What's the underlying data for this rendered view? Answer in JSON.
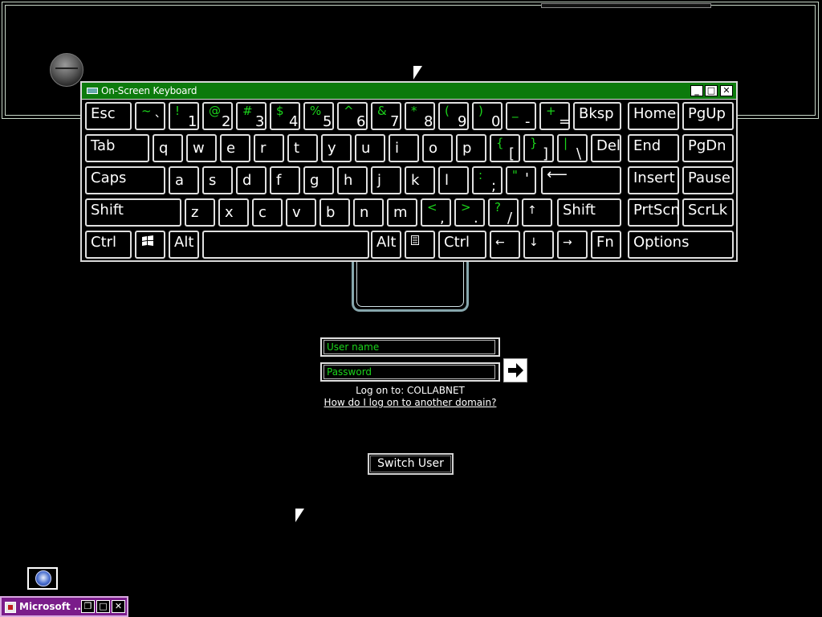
{
  "osk": {
    "title": "On-Screen Keyboard",
    "minimize": "_",
    "maximize": "□",
    "close": "✕"
  },
  "keys": {
    "esc": "Esc",
    "tab": "Tab",
    "caps": "Caps",
    "shift_l": "Shift",
    "ctrl_l": "Ctrl",
    "alt_l": "Alt",
    "alt_r": "Alt",
    "ctrl_r": "Ctrl",
    "fn": "Fn",
    "options": "Options",
    "bksp": "Bksp",
    "del": "Del",
    "shift_r": "Shift",
    "home": "Home",
    "pgup": "PgUp",
    "end": "End",
    "pgdn": "PgDn",
    "insert": "Insert",
    "pause": "Pause",
    "prtscn": "PrtScn",
    "scrlk": "ScrLk",
    "n1": [
      "!",
      "1"
    ],
    "n2": [
      "@",
      "2"
    ],
    "n3": [
      "#",
      "3"
    ],
    "n4": [
      "$",
      "4"
    ],
    "n5": [
      "%",
      "5"
    ],
    "n6": [
      "^",
      "6"
    ],
    "n7": [
      "&",
      "7"
    ],
    "n8": [
      "*",
      "8"
    ],
    "n9": [
      "(",
      "9"
    ],
    "n0": [
      ")",
      "0"
    ],
    "tilde": [
      "~",
      "`"
    ],
    "minus": [
      "_",
      "-"
    ],
    "equals": [
      "+",
      "="
    ],
    "lbr": [
      "{",
      "["
    ],
    "rbr": [
      "}",
      "]"
    ],
    "bslash": [
      "|",
      "\\"
    ],
    "semi": [
      ":",
      ";"
    ],
    "quote": [
      "\"",
      "'"
    ],
    "comma": [
      "<",
      ","
    ],
    "period": [
      ">",
      "."
    ],
    "slash": [
      "?",
      "/"
    ],
    "q": "q",
    "w": "w",
    "e": "e",
    "r": "r",
    "t": "t",
    "y": "y",
    "u": "u",
    "i": "i",
    "o": "o",
    "p": "p",
    "a": "a",
    "s": "s",
    "d": "d",
    "f": "f",
    "g": "g",
    "h": "h",
    "j": "j",
    "k": "k",
    "l": "l",
    "z": "z",
    "x": "x",
    "c": "c",
    "v": "v",
    "b": "b",
    "n": "n",
    "m": "m",
    "up": "↑",
    "down": "↓",
    "left": "←",
    "right": "→",
    "enter": "⟵"
  },
  "login": {
    "username_placeholder": "User name",
    "password_placeholder": "Password",
    "logon_to": "Log on to: COLLABNET",
    "other_domain_link": "How do I log on to another domain?",
    "switch_user": "Switch User"
  },
  "taskbar": {
    "label": "Microsoft ..."
  },
  "colors": {
    "accent_green": "#1bd41b",
    "title_green": "#0c7a0c",
    "taskbar_purple": "#7a1c8a"
  }
}
